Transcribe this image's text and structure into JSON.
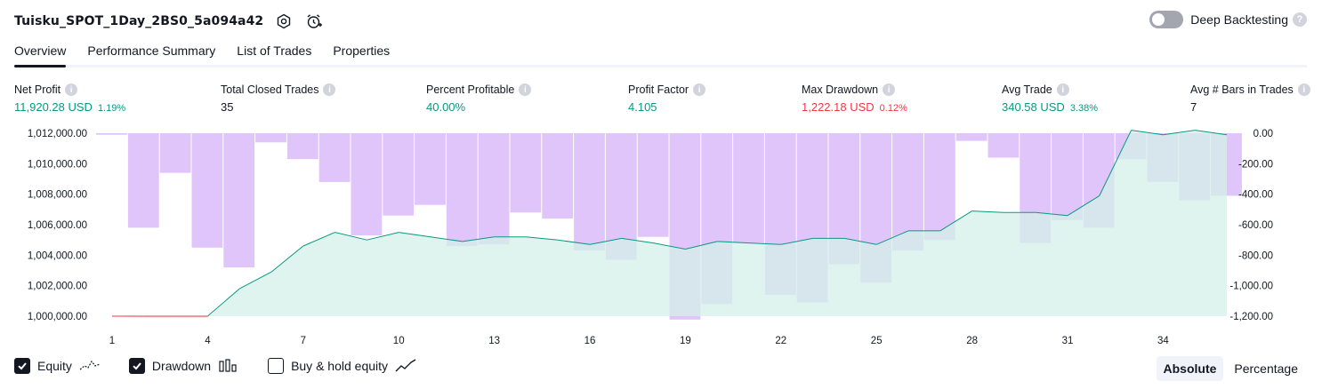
{
  "header": {
    "title": "Tuisku_SPOT_1Day_2BS0_5a094a42",
    "settings_icon": "gear-icon",
    "alert_icon": "alarm-clock-plus-icon"
  },
  "deep_backtesting": {
    "label": "Deep Backtesting",
    "enabled": false,
    "help": "?"
  },
  "tabs": [
    {
      "label": "Overview",
      "active": true
    },
    {
      "label": "Performance Summary",
      "active": false
    },
    {
      "label": "List of Trades",
      "active": false
    },
    {
      "label": "Properties",
      "active": false
    }
  ],
  "metrics": [
    {
      "label": "Net Profit",
      "value": "11,920.28 USD",
      "pct": "1.19%",
      "color": "green"
    },
    {
      "label": "Total Closed Trades",
      "value": "35",
      "pct": "",
      "color": "dark"
    },
    {
      "label": "Percent Profitable",
      "value": "40.00%",
      "pct": "",
      "color": "green"
    },
    {
      "label": "Profit Factor",
      "value": "4.105",
      "pct": "",
      "color": "green"
    },
    {
      "label": "Max Drawdown",
      "value": "1,222.18 USD",
      "pct": "0.12%",
      "color": "red"
    },
    {
      "label": "Avg Trade",
      "value": "340.58 USD",
      "pct": "3.38%",
      "color": "green"
    },
    {
      "label": "Avg # Bars in Trades",
      "value": "7",
      "pct": "",
      "color": "dark"
    }
  ],
  "chart_data": {
    "type": "line",
    "x_ticks": [
      "1",
      "4",
      "7",
      "10",
      "13",
      "16",
      "19",
      "22",
      "25",
      "28",
      "31",
      "34"
    ],
    "x_tick_values": [
      1,
      4,
      7,
      10,
      13,
      16,
      19,
      22,
      25,
      28,
      31,
      34
    ],
    "left_axis": {
      "ticks": [
        "1,012,000.00",
        "1,010,000.00",
        "1,008,000.00",
        "1,006,000.00",
        "1,004,000.00",
        "1,002,000.00",
        "1,000,000.00"
      ],
      "tick_values": [
        1012000,
        1010000,
        1008000,
        1006000,
        1004000,
        1002000,
        1000000
      ],
      "range": [
        1000000,
        1012000
      ]
    },
    "right_axis": {
      "ticks": [
        "0.00",
        "-200.00",
        "-400.00",
        "-600.00",
        "-800.00",
        "-1,000.00",
        "-1,200.00"
      ],
      "tick_values": [
        0,
        -200,
        -400,
        -600,
        -800,
        -1000,
        -1200
      ],
      "range": [
        -1200,
        0
      ]
    },
    "equity": {
      "name": "Equity",
      "x": [
        1,
        2,
        3,
        4,
        5,
        6,
        7,
        8,
        9,
        10,
        11,
        12,
        13,
        14,
        15,
        16,
        17,
        18,
        19,
        20,
        21,
        22,
        23,
        24,
        25,
        26,
        27,
        28,
        29,
        30,
        31,
        32,
        33,
        34,
        35,
        36
      ],
      "values": [
        1000000,
        999900,
        999900,
        999900,
        1001800,
        1002900,
        1004600,
        1005500,
        1005000,
        1005500,
        1005200,
        1004900,
        1005200,
        1005200,
        1005000,
        1004700,
        1005100,
        1004800,
        1004400,
        1004900,
        1004800,
        1004700,
        1005100,
        1005100,
        1004700,
        1005600,
        1005600,
        1006900,
        1006800,
        1006800,
        1006600,
        1007900,
        1012200,
        1011900,
        1012200,
        1011900
      ],
      "up_color": "#089981",
      "down_color": "#f23645",
      "fill": "#d4f0e8"
    },
    "drawdown": {
      "name": "Drawdown",
      "values": [
        -10,
        -620,
        -260,
        -750,
        -880,
        -60,
        -170,
        -320,
        -670,
        -540,
        -470,
        -740,
        -730,
        -520,
        -560,
        -770,
        -830,
        -680,
        -1222,
        -1120,
        -720,
        -1060,
        -1110,
        -860,
        -980,
        -770,
        -700,
        -50,
        -160,
        -720,
        -570,
        -620,
        -170,
        -320,
        -440,
        -410
      ],
      "color": "#cfa6f7"
    },
    "grid": false
  },
  "legend": [
    {
      "label": "Equity",
      "checked": true,
      "icon": "equity-line-icon"
    },
    {
      "label": "Drawdown",
      "checked": true,
      "icon": "drawdown-bars-icon"
    },
    {
      "label": "Buy & hold equity",
      "checked": false,
      "icon": "buy-hold-line-icon"
    }
  ],
  "modes": [
    {
      "label": "Absolute",
      "active": true
    },
    {
      "label": "Percentage",
      "active": false
    }
  ]
}
